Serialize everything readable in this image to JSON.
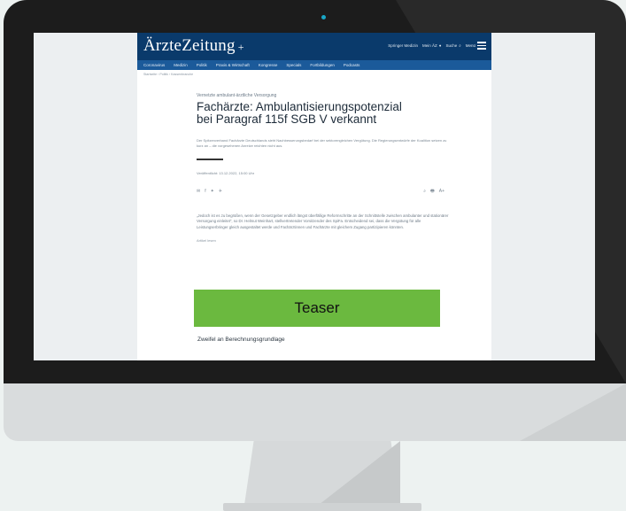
{
  "site": {
    "logo": "ÄrzteZeitung",
    "logo_plus": "+",
    "header_links": [
      "Springer Medizin",
      "Mein ÄZ",
      "Suche",
      "Menü"
    ],
    "nav_items": [
      "Coronavirus",
      "Medizin",
      "Politik",
      "Praxis & Wirtschaft",
      "Kongresse",
      "Specials",
      "Fortbildungen",
      "Podcasts"
    ],
    "breadcrumb": "Startseite › Politik › Kassenbranche"
  },
  "article": {
    "kicker": "Vernetzte ambulant-ärztliche Versorgung",
    "headline_line1": "Fachärzte: Ambulantisierungspotenzial",
    "headline_line2": "bei Paragraf 115f SGB V verkannt",
    "lead": "Der Spitzenverband Fachärzte Deutschlands sieht Nachbesserungsbedarf bei der sektorengleichen Vergütung. Die Regierungsentwürfe der Koalition setzen zu kurz an – die vorgesehenen Anreize reichten nicht aus.",
    "date": "Veröffentlicht: 13.12.2022, 15:00 Uhr",
    "share_left": [
      "✉",
      "f",
      "✦",
      "✈"
    ],
    "share_right": [
      "⌕",
      "🖶",
      "A+"
    ],
    "body": "„Jedoch ist es zu begrüßen, wenn der Gesetzgeber endlich längst überfällige Reformschritte an der Schnittstelle zwischen ambulanter und stationärer Versorgung einleitet“, so Dr. Helmut Weinhart, stellvertretender Vorsitzender des SpiFa. Entscheidend sei, dass die Vergütung für alle Leistungserbringer gleich ausgestaltet werde und Fachärztinnen und Fachärzte mit gleichem Zugang partizipieren könnten.",
    "more": "Artikel lesen",
    "teaser": "Teaser",
    "subheading": "Zweifel an Berechnungsgrundlage"
  }
}
